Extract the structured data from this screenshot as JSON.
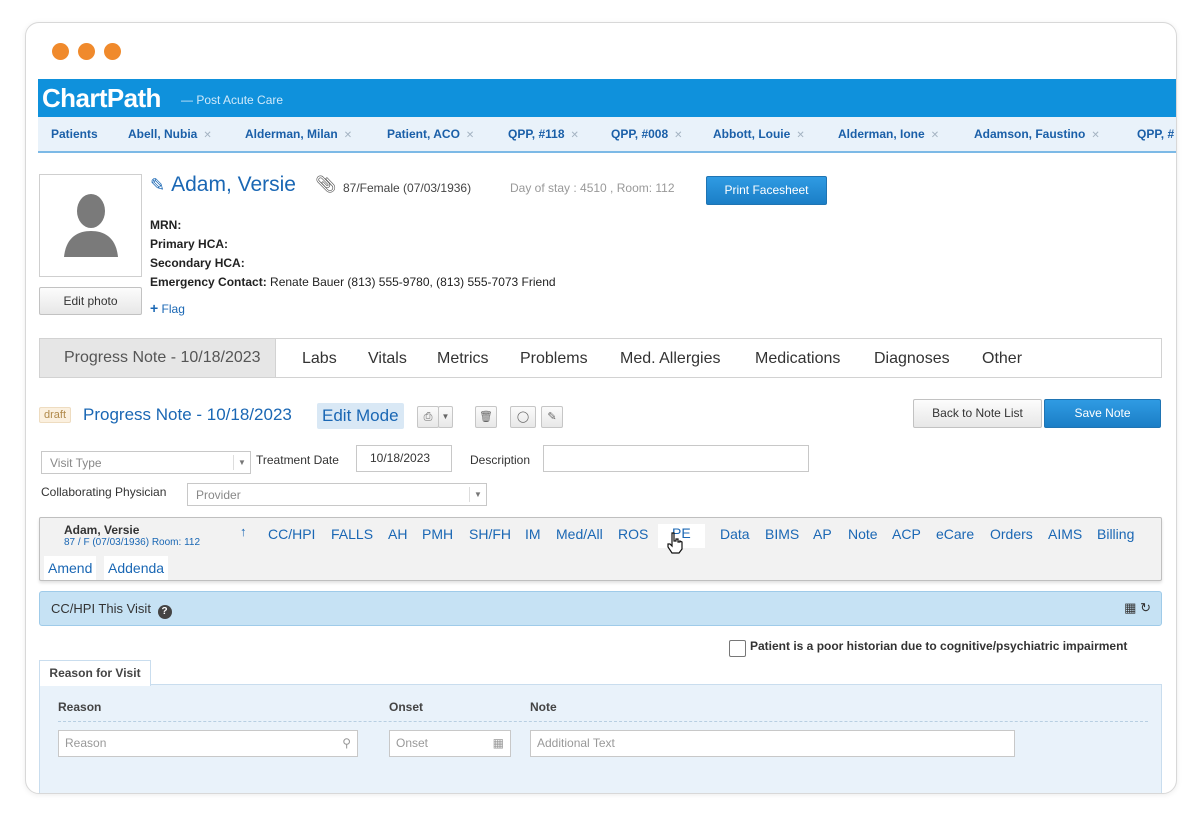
{
  "app": {
    "brand": "ChartPath",
    "brand_sub": "— Post Acute Care"
  },
  "patient_tabs": [
    {
      "label": "Patients",
      "closable": false
    },
    {
      "label": "Abell, Nubia",
      "closable": true
    },
    {
      "label": "Alderman, Milan",
      "closable": true
    },
    {
      "label": "Patient, ACO",
      "closable": true
    },
    {
      "label": "QPP, #118",
      "closable": true
    },
    {
      "label": "QPP, #008",
      "closable": true
    },
    {
      "label": "Abbott, Louie",
      "closable": true
    },
    {
      "label": "Alderman, Ione",
      "closable": true
    },
    {
      "label": "Adamson, Faustino",
      "closable": true
    },
    {
      "label": "QPP, #",
      "closable": false
    }
  ],
  "patient": {
    "name": "Adam, Versie",
    "age_sex_dob": "87/Female (07/03/1936)",
    "stay": "Day of stay : 4510 , Room: 112",
    "print_label": "Print Facesheet",
    "edit_photo": "Edit photo",
    "flag": "Flag",
    "mrn_label": "MRN:",
    "primary_hca_label": "Primary HCA:",
    "secondary_hca_label": "Secondary HCA:",
    "emergency_label": "Emergency Contact:",
    "emergency_value": "Renate Bauer (813) 555-9780, (813) 555-7073 Friend"
  },
  "nav_tabs": [
    "Progress Note - 10/18/2023",
    "Labs",
    "Vitals",
    "Metrics",
    "Problems",
    "Med. Allergies",
    "Medications",
    "Diagnoses",
    "Other"
  ],
  "note": {
    "draft": "draft",
    "title": "Progress Note - 10/18/2023",
    "edit_mode": "Edit Mode",
    "back_label": "Back to Note List",
    "save_label": "Save Note"
  },
  "form": {
    "visit_type_placeholder": "Visit Type",
    "treatment_date_label": "Treatment Date",
    "treatment_date_value": "10/18/2023",
    "description_label": "Description",
    "collab_label": "Collaborating Physician",
    "provider_placeholder": "Provider"
  },
  "section_nav": {
    "name": "Adam, Versie",
    "sub": "87 / F  (07/03/1936)   Room: 112",
    "links": [
      "CC/HPI",
      "FALLS",
      "AH",
      "PMH",
      "SH/FH",
      "IM",
      "Med/All",
      "ROS",
      "PE",
      "Data",
      "BIMS",
      "AP",
      "Note",
      "ACP",
      "eCare",
      "Orders",
      "AIMS",
      "Billing"
    ],
    "row2": [
      "Amend",
      "Addenda"
    ]
  },
  "cchpi": {
    "title": "CC/HPI This Visit",
    "poor_historian_label": "Patient is a poor historian due to cognitive/psychiatric impairment"
  },
  "reason": {
    "tab_label": "Reason for Visit",
    "col_reason": "Reason",
    "col_onset": "Onset",
    "col_note": "Note",
    "reason_placeholder": "Reason",
    "onset_placeholder": "Onset",
    "note_placeholder": "Additional Text"
  },
  "colors": {
    "brand_blue": "#0f91dc",
    "link_blue": "#1a67b4",
    "window_dot": "#f08a2c"
  }
}
